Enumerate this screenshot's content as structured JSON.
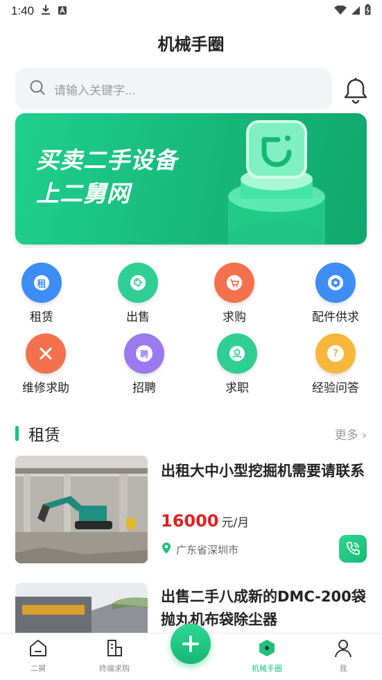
{
  "status_bar": {
    "time": "1:40"
  },
  "header": {
    "title": "机械手圈"
  },
  "search": {
    "placeholder": "请输入关键字..."
  },
  "banner": {
    "line1": "买卖二手设备",
    "line2": "上二舅网"
  },
  "quick_actions": [
    {
      "label": "租赁",
      "icon_text": "租",
      "icon": "rent-icon",
      "color": "#3d8df5"
    },
    {
      "label": "出售",
      "icon_text": "",
      "icon": "tag-icon",
      "color": "#2fcf93"
    },
    {
      "label": "求购",
      "icon_text": "",
      "icon": "cart-icon",
      "color": "#f4714e"
    },
    {
      "label": "配件供求",
      "icon_text": "",
      "icon": "nut-icon",
      "color": "#3d8df5"
    },
    {
      "label": "维修求助",
      "icon_text": "",
      "icon": "tools-icon",
      "color": "#f4714e"
    },
    {
      "label": "招聘",
      "icon_text": "聘",
      "icon": "hire-icon",
      "color": "#9b79ee"
    },
    {
      "label": "求职",
      "icon_text": "",
      "icon": "job-search-icon",
      "color": "#2fcf93"
    },
    {
      "label": "经验问答",
      "icon_text": "?",
      "icon": "question-icon",
      "color": "#f7b73b"
    }
  ],
  "section": {
    "title": "租赁",
    "more": "更多"
  },
  "listings": [
    {
      "title": "出租大中小型挖掘机需要请联系",
      "price": "16000",
      "unit": "元/月",
      "location": "广东省深圳市"
    },
    {
      "title": "出售二手八成新的DMC-200袋抛丸机布袋除尘器"
    }
  ],
  "bottom_nav": [
    {
      "label": "二舅",
      "icon": "home-icon"
    },
    {
      "label": "终端求购",
      "icon": "building-icon"
    },
    {
      "label": "机械手圈",
      "icon": "hexagon-icon"
    },
    {
      "label": "我",
      "icon": "person-icon"
    }
  ],
  "colors": {
    "accent": "#20c07c",
    "price": "#e02020"
  }
}
